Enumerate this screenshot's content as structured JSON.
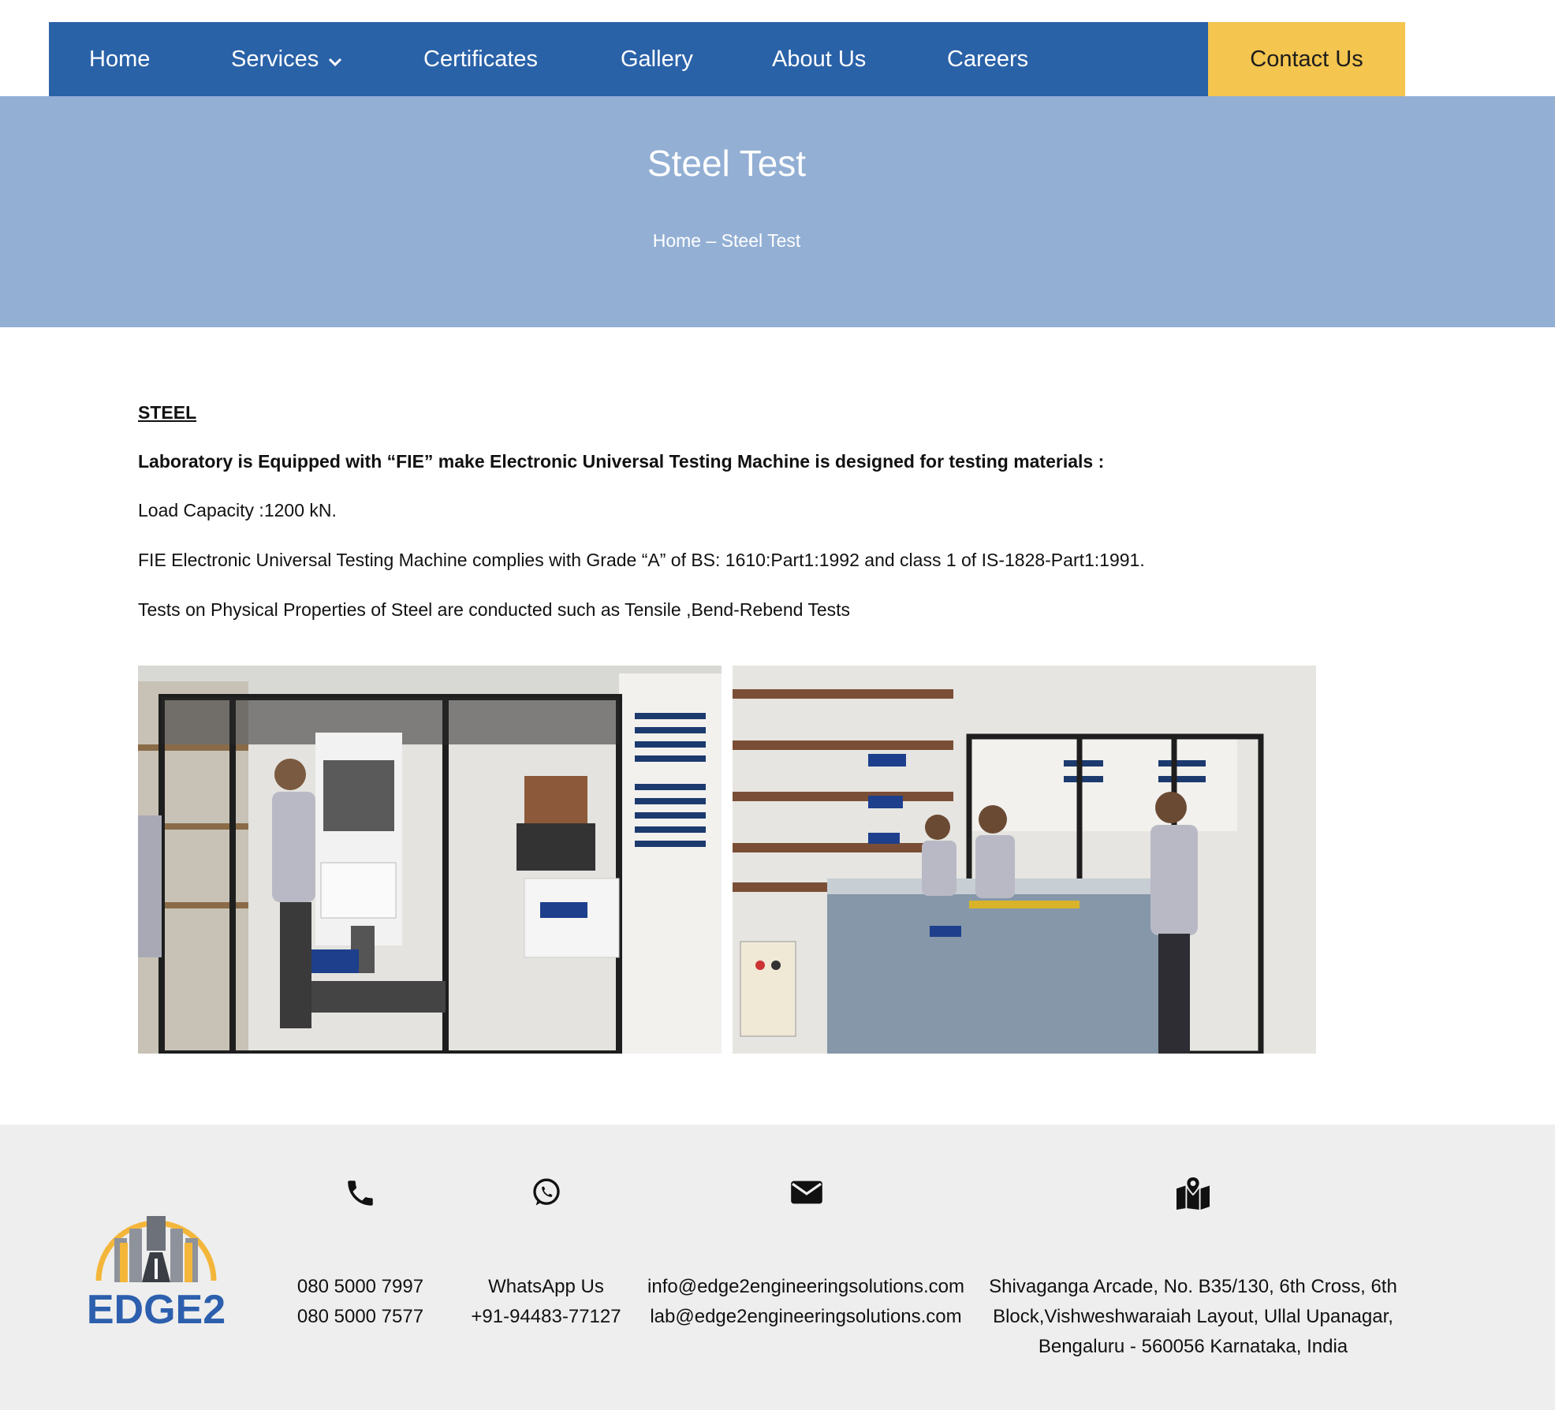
{
  "nav": {
    "items": [
      "Home",
      "Services",
      "Certificates",
      "Gallery",
      "About Us",
      "Careers"
    ],
    "contact_label": "Contact Us",
    "bg_color": "#2a62a8",
    "contact_color": "#f4c54f"
  },
  "hero": {
    "title": "Steel Test",
    "breadcrumb": {
      "home": "Home",
      "separator": "–",
      "current": "Steel Test"
    },
    "bg_color": "#93afd4"
  },
  "content": {
    "heading": "STEEL",
    "intro_bold": "Laboratory is Equipped with “FIE” make Electronic Universal Testing Machine is designed for testing materials :",
    "load_capacity": "Load Capacity :1200 kN.",
    "compliance": "FIE Electronic Universal Testing Machine complies with Grade “A” of BS: 1610:Part1:1992 and class 1 of IS-1828-Part1:1991.",
    "tests": "Tests on Physical Properties of Steel are conducted such as Tensile ,Bend-Rebend Tests",
    "photos": [
      "utm-machine-photo",
      "steel-section-photo"
    ]
  },
  "footer": {
    "logo_text": "EDGE2",
    "phone": {
      "icon": "phone-icon",
      "lines": [
        "080 5000 7997",
        "080 5000 7577"
      ]
    },
    "whatsapp": {
      "icon": "whatsapp-icon",
      "lines": [
        "WhatsApp Us",
        "+91-94483-77127"
      ]
    },
    "email": {
      "icon": "envelope-icon",
      "lines": [
        "info@edge2engineeringsolutions.com",
        "lab@edge2engineeringsolutions.com"
      ]
    },
    "address": {
      "icon": "map-pin-icon",
      "lines": [
        "Shivaganga Arcade, No. B35/130, 6th Cross, 6th",
        "Block,Vishweshwaraiah Layout, Ullal Upanagar,",
        "Bengaluru - 560056 Karnataka, India"
      ]
    }
  }
}
